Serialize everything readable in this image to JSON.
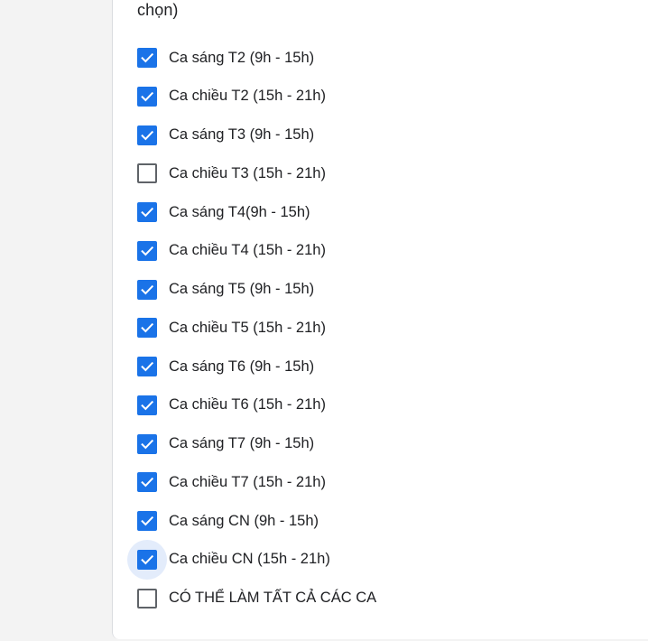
{
  "question": {
    "title_tail": "chọn)"
  },
  "options": [
    {
      "label": "Ca sáng T2 (9h - 15h)",
      "checked": true
    },
    {
      "label": "Ca chiều T2 (15h - 21h)",
      "checked": true
    },
    {
      "label": "Ca sáng T3 (9h - 15h)",
      "checked": true
    },
    {
      "label": "Ca chiều T3 (15h - 21h)",
      "checked": false
    },
    {
      "label": "Ca sáng T4(9h - 15h)",
      "checked": true
    },
    {
      "label": "Ca chiều T4 (15h - 21h)",
      "checked": true
    },
    {
      "label": "Ca sáng T5 (9h - 15h)",
      "checked": true
    },
    {
      "label": "Ca chiều T5 (15h - 21h)",
      "checked": true
    },
    {
      "label": "Ca sáng T6 (9h - 15h)",
      "checked": true
    },
    {
      "label": "Ca chiều T6 (15h - 21h)",
      "checked": true
    },
    {
      "label": "Ca sáng T7 (9h - 15h)",
      "checked": true
    },
    {
      "label": "Ca chiều T7 (15h - 21h)",
      "checked": true
    },
    {
      "label": "Ca sáng CN (9h - 15h)",
      "checked": true
    },
    {
      "label": "Ca chiều CN (15h - 21h)",
      "checked": true,
      "focused": true
    },
    {
      "label": "CÓ THỂ LÀM TẤT CẢ CÁC CA",
      "checked": false
    }
  ],
  "colors": {
    "accent": "#1a73e8",
    "focus_ring": "#e3ecfb",
    "text": "#202124",
    "unchecked_border": "#5f6368"
  }
}
